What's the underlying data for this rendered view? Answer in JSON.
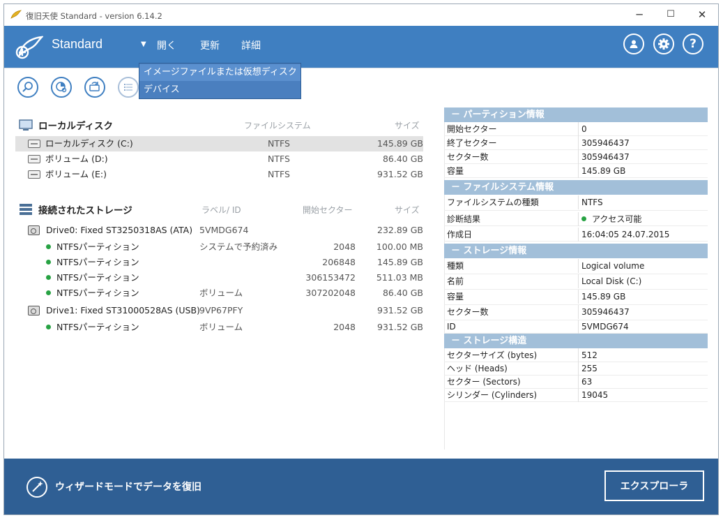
{
  "window": {
    "title": "復旧天使 Standard - version 6.14.2",
    "minimize": "─",
    "maximize": "☐",
    "close": "✕"
  },
  "toolbar": {
    "brand": "Standard",
    "menu_arrow": "▼",
    "open": "開く",
    "refresh": "更新",
    "details": "詳細"
  },
  "dropdown": {
    "options": [
      "イメージファイルまたは仮想ディスク",
      "デバイス"
    ]
  },
  "icons": [
    "search-disk-icon",
    "partition-scan-icon",
    "refresh-icon",
    "list-icon",
    "user-icon",
    "settings-icon",
    "help-icon",
    "wizard-icon"
  ],
  "local": {
    "header": "ローカルディスク",
    "col_fs": "ファイルシステム",
    "col_size": "サイズ",
    "rows": [
      {
        "name": "ローカルディスク (C:)",
        "fs": "NTFS",
        "size": "145.89 GB"
      },
      {
        "name": "ボリューム (D:)",
        "fs": "NTFS",
        "size": "86.40 GB"
      },
      {
        "name": "ボリューム (E:)",
        "fs": "NTFS",
        "size": "931.52 GB"
      }
    ]
  },
  "storage": {
    "header": "接続されたストレージ",
    "col_label": "ラベル/ ID",
    "col_start": "開始セクター",
    "col_size": "サイズ",
    "rows": [
      {
        "name": "Drive0: Fixed ST3250318AS (ATA)",
        "label": "5VMDG674",
        "start": "",
        "size": "232.89 GB"
      },
      {
        "name": "NTFSパーティション",
        "label": "システムで予約済み",
        "start": "2048",
        "size": "100.00 MB"
      },
      {
        "name": "NTFSパーティション",
        "label": "",
        "start": "206848",
        "size": "145.89 GB"
      },
      {
        "name": "NTFSパーティション",
        "label": "",
        "start": "306153472",
        "size": "511.03 MB"
      },
      {
        "name": "NTFSパーティション",
        "label": "ボリューム",
        "start": "307202048",
        "size": "86.40 GB"
      },
      {
        "name": "Drive1: Fixed ST31000528AS (USB)",
        "label": "9VP67PFY",
        "start": "",
        "size": "931.52 GB"
      },
      {
        "name": "NTFSパーティション",
        "label": "ボリューム",
        "start": "2048",
        "size": "931.52 GB"
      }
    ]
  },
  "info": {
    "partition": {
      "header": "－ パーティション情報",
      "rows": [
        {
          "k": "開始セクター",
          "v": "0"
        },
        {
          "k": "終了セクター",
          "v": "305946437"
        },
        {
          "k": "セクター数",
          "v": "305946437"
        },
        {
          "k": "容量",
          "v": "145.89 GB"
        }
      ]
    },
    "filesystem": {
      "header": "－ ファイルシステム情報",
      "rows": [
        {
          "k": "ファイルシステムの種類",
          "v": "NTFS"
        },
        {
          "k": "診断結果",
          "v": "アクセス可能"
        },
        {
          "k": "作成日",
          "v": "16:04:05 24.07.2015"
        }
      ]
    },
    "storage": {
      "header": "－ ストレージ情報",
      "rows": [
        {
          "k": "種類",
          "v": "Logical volume"
        },
        {
          "k": "名前",
          "v": "Local Disk (C:)"
        },
        {
          "k": "容量",
          "v": "145.89 GB"
        },
        {
          "k": "セクター数",
          "v": "305946437"
        },
        {
          "k": "ID",
          "v": "5VMDG674"
        }
      ]
    },
    "structure": {
      "header": "－ ストレージ構造",
      "rows": [
        {
          "k": "セクターサイズ (bytes)",
          "v": "512"
        },
        {
          "k": "ヘッド (Heads)",
          "v": "255"
        },
        {
          "k": "セクター (Sectors)",
          "v": "63"
        },
        {
          "k": "シリンダー (Cylinders)",
          "v": "19045"
        }
      ]
    }
  },
  "footer": {
    "wizard": "ウィザードモードでデータを復旧",
    "explorer": "エクスプローラ"
  },
  "colors": {
    "toolbar": "#3f7fc1",
    "footer": "#2f5f94",
    "panel_header": "#a2bfd9",
    "status_ok": "#27a243"
  }
}
